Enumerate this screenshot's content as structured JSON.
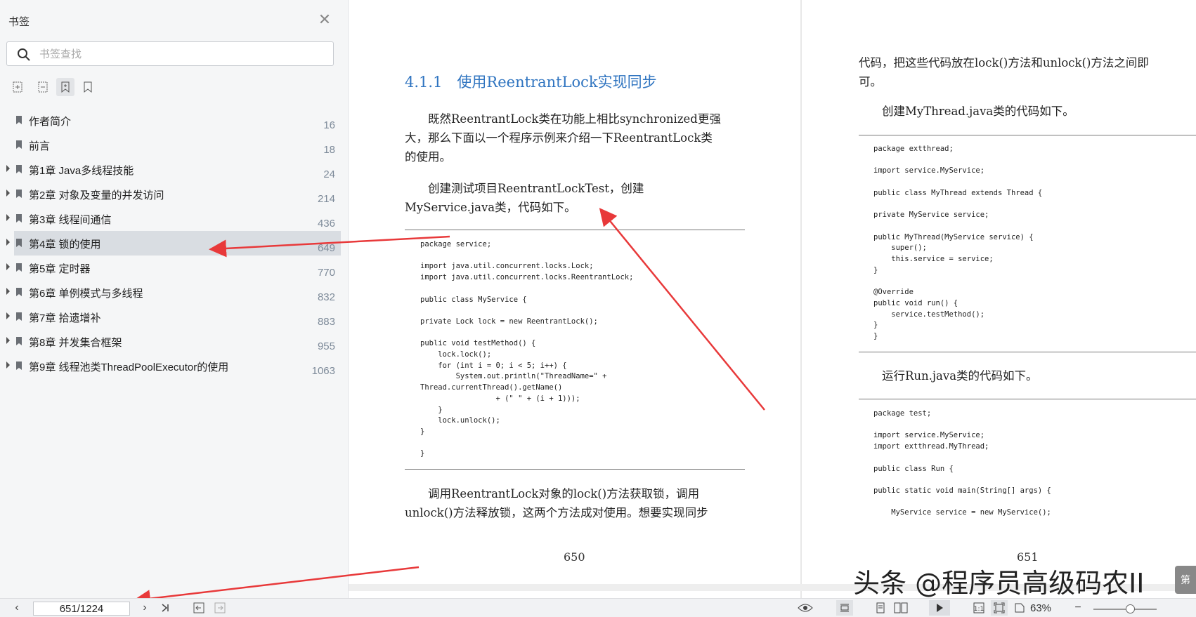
{
  "sidebar": {
    "title": "书签",
    "search_placeholder": "书签查找",
    "items": [
      {
        "label": "作者简介",
        "page": "16",
        "expandable": false
      },
      {
        "label": "前言",
        "page": "18",
        "expandable": false
      },
      {
        "label": "第1章 Java多线程技能",
        "page": "24",
        "expandable": true
      },
      {
        "label": "第2章 对象及变量的并发访问",
        "page": "214",
        "expandable": true
      },
      {
        "label": "第3章 线程间通信",
        "page": "436",
        "expandable": true
      },
      {
        "label": "第4章 锁的使用",
        "page": "649",
        "expandable": true,
        "selected": true
      },
      {
        "label": "第5章 定时器",
        "page": "770",
        "expandable": true
      },
      {
        "label": "第6章 单例模式与多线程",
        "page": "832",
        "expandable": true
      },
      {
        "label": "第7章 拾遗增补",
        "page": "883",
        "expandable": true
      },
      {
        "label": "第8章 并发集合框架",
        "page": "955",
        "expandable": true
      },
      {
        "label": "第9章 线程池类ThreadPoolExecutor的使用",
        "page": "1063",
        "expandable": true
      }
    ]
  },
  "left_page": {
    "heading": "4.1.1  使用ReentrantLock实现同步",
    "para1": [
      "　　既然ReentrantLock类在功能上相比synchronized更强",
      "大，那么下面以一个程序示例来介绍一下ReentrantLock类",
      "的使用。"
    ],
    "para2": [
      "　　创建测试项目ReentrantLockTest，创建",
      "MyService.java类，代码如下。"
    ],
    "code": "package service;\n\nimport java.util.concurrent.locks.Lock;\nimport java.util.concurrent.locks.ReentrantLock;\n\npublic class MyService {\n\nprivate Lock lock = new ReentrantLock();\n\npublic void testMethod() {\n    lock.lock();\n    for (int i = 0; i < 5; i++) {\n        System.out.println(\"ThreadName=\" +\nThread.currentThread().getName()\n                 + (\" \" + (i + 1)));\n    }\n    lock.unlock();\n}\n\n}",
    "para3": [
      "　　调用ReentrantLock对象的lock()方法获取锁，调用",
      "unlock()方法释放锁，这两个方法成对使用。想要实现同步"
    ],
    "page_number": "650"
  },
  "right_page": {
    "para1": [
      "代码，把这些代码放在lock()方法和unlock()方法之间即",
      "可。"
    ],
    "para2": "　　创建MyThread.java类的代码如下。",
    "code1": "package extthread;\n\nimport service.MyService;\n\npublic class MyThread extends Thread {\n\nprivate MyService service;\n\npublic MyThread(MyService service) {\n    super();\n    this.service = service;\n}\n\n@Override\npublic void run() {\n    service.testMethod();\n}\n}",
    "para3": "　　运行Run.java类的代码如下。",
    "code2": "package test;\n\nimport service.MyService;\nimport extthread.MyThread;\n\npublic class Run {\n\npublic static void main(String[] args) {\n\n    MyService service = new MyService();",
    "page_number": "651"
  },
  "watermark": "头条 @程序员高级码农II",
  "side_tab": "第",
  "bottombar": {
    "page_field": "651/1224",
    "zoom": "63%"
  },
  "colors": {
    "heading_blue": "#2f74c0",
    "selection": "#d9dde2",
    "annotation_arrow": "#e8393a"
  }
}
